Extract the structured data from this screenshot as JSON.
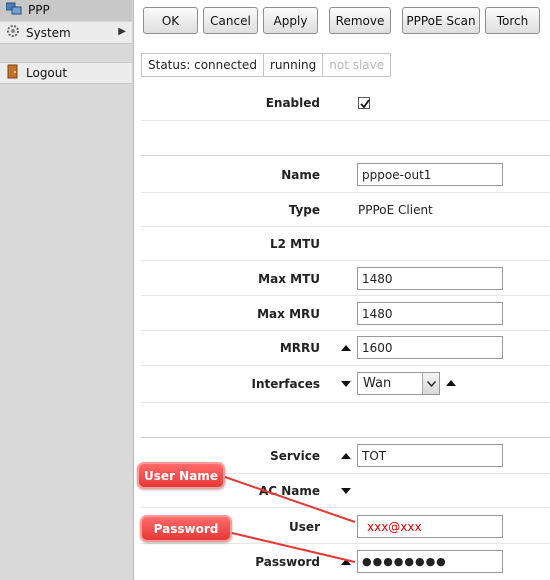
{
  "sidebar": {
    "items": [
      {
        "label": "PPP",
        "icon": "ppp-icon"
      },
      {
        "label": "System",
        "icon": "gear-icon"
      },
      {
        "label": "Logout",
        "icon": "door-icon"
      }
    ]
  },
  "toolbar": {
    "ok": "OK",
    "cancel": "Cancel",
    "apply": "Apply",
    "remove": "Remove",
    "pppoe_scan": "PPPoE Scan",
    "torch": "Torch"
  },
  "status": {
    "connection": "Status: connected",
    "state": "running",
    "slave": "not slave"
  },
  "form": {
    "enabled_label": "Enabled",
    "enabled": true,
    "name_label": "Name",
    "name_value": "pppoe-out1",
    "type_label": "Type",
    "type_value": "PPPoE Client",
    "l2mtu_label": "L2 MTU",
    "max_mtu_label": "Max MTU",
    "max_mtu_value": "1480",
    "max_mru_label": "Max MRU",
    "max_mru_value": "1480",
    "mrru_label": "MRRU",
    "mrru_value": "1600",
    "interfaces_label": "Interfaces",
    "interfaces_value": "Wan",
    "service_label": "Service",
    "service_value": "TOT",
    "ac_name_label": "AC Name",
    "user_label": "User",
    "user_value": "xxx@xxx",
    "password_label": "Password",
    "password_value": "●●●●●●●●"
  },
  "annotations": {
    "user_name": "User Name",
    "password": "Password",
    "color": "#e53935"
  }
}
